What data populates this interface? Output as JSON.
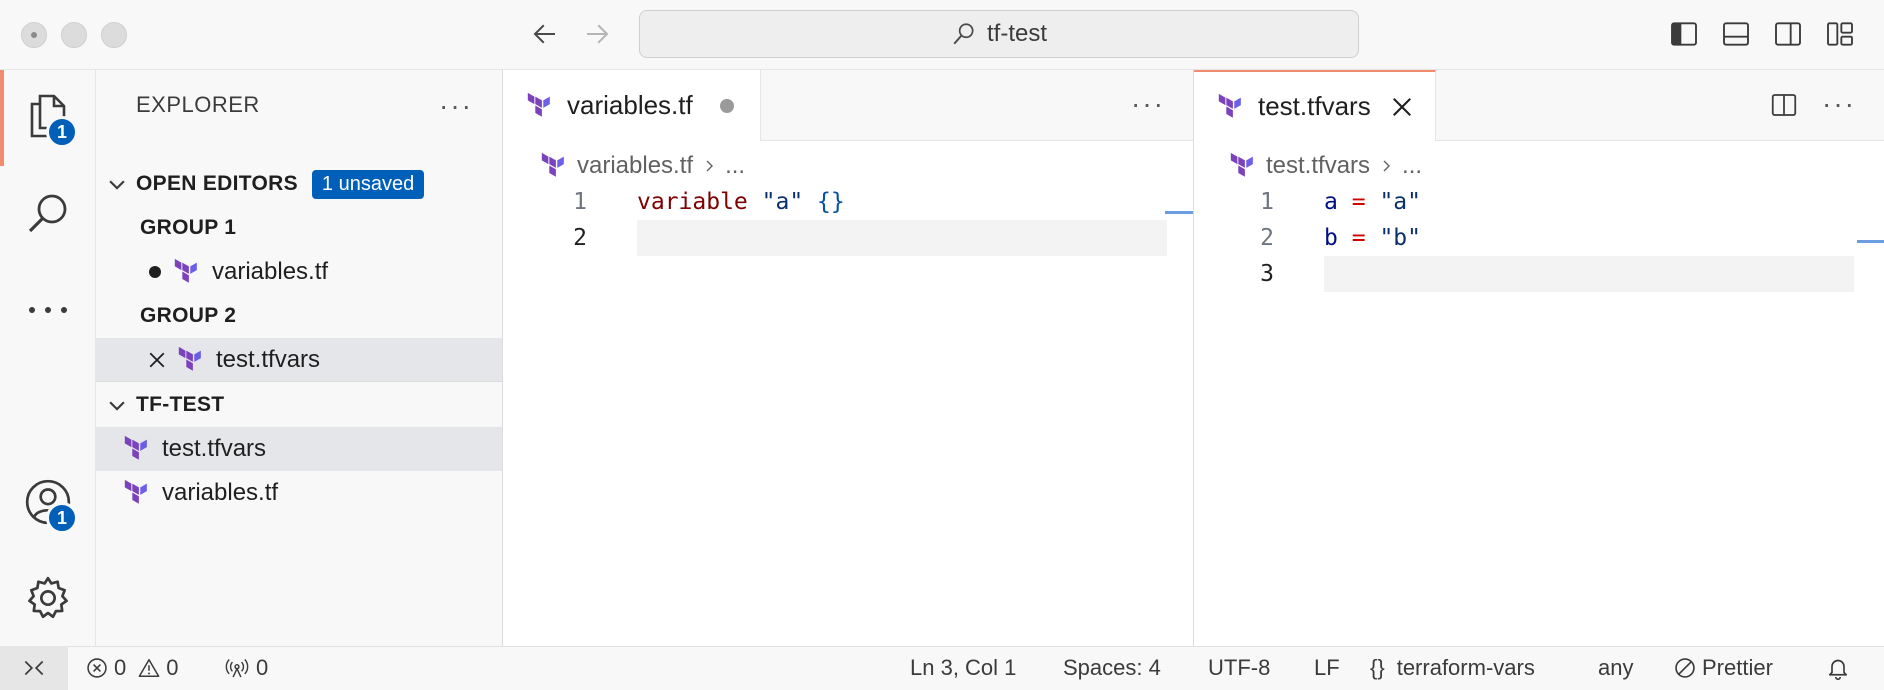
{
  "window": {
    "title": "tf-test"
  },
  "activity": {
    "explorer_badge": "1",
    "accounts_badge": "1"
  },
  "sidebar": {
    "title": "EXPLORER",
    "more": "···",
    "open_editors": {
      "label": "OPEN EDITORS",
      "badge": "1 unsaved",
      "group1_label": "GROUP 1",
      "group1_file": "variables.tf",
      "group2_label": "GROUP 2",
      "group2_file": "test.tfvars"
    },
    "folder": {
      "label": "TF-TEST",
      "files": [
        "test.tfvars",
        "variables.tf"
      ]
    }
  },
  "editor1": {
    "tab_label": "variables.tf",
    "breadcrumb_file": "variables.tf",
    "breadcrumb_more": "...",
    "more": "···",
    "line_numbers": [
      "1",
      "2"
    ],
    "line1": {
      "kw": "variable",
      "str": "\"a\"",
      "brace": "{}"
    }
  },
  "editor2": {
    "tab_label": "test.tfvars",
    "breadcrumb_file": "test.tfvars",
    "breadcrumb_more": "...",
    "more": "···",
    "line_numbers": [
      "1",
      "2",
      "3"
    ],
    "line1": {
      "ident": "a",
      "op": "=",
      "str": "\"a\""
    },
    "line2": {
      "ident": "b",
      "op": "=",
      "str": "\"b\""
    }
  },
  "statusbar": {
    "errors": "0",
    "warnings": "0",
    "ports": "0",
    "cursor": "Ln 3, Col 1",
    "spaces": "Spaces: 4",
    "encoding": "UTF-8",
    "eol": "LF",
    "language": "terraform-vars",
    "braces": "{}",
    "any": "any",
    "formatter": "Prettier"
  },
  "colors": {
    "accent": "#005fb8",
    "active_indicator": "#f38c6f",
    "terraform": "#7b42bc"
  }
}
